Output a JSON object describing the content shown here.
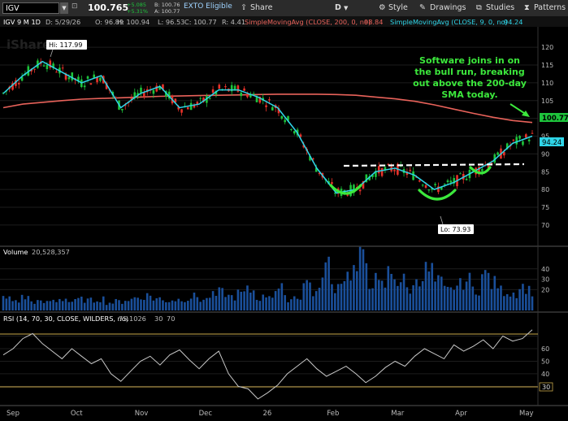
{
  "toolbar": {
    "symbol": "IGV",
    "last": "100.765",
    "change_line1": "+5.085",
    "change_line2": "+5.31%",
    "bid": "B: 100.76",
    "ask": "A: 100.77",
    "exto": "EXTO Eligible",
    "share": "Share",
    "d_label": "D",
    "style": "Style",
    "drawings": "Drawings",
    "studies": "Studies",
    "patterns": "Patterns"
  },
  "header": {
    "period": "IGV 9 M 1D",
    "date": "D: 5/29/26",
    "open": "O: 96.89",
    "high": "H: 100.94",
    "low": "L: 96.53",
    "close": "C: 100.77",
    "range": "R: 4.41",
    "sma200_label": "SimpleMovingAvg (CLOSE, 200, 0, no)",
    "sma200_value": "98.84",
    "sma9_label": "SimpleMovingAvg (CLOSE, 9, 0, no)",
    "sma9_value": "94.24",
    "watermark": "iShares"
  },
  "annotations": {
    "hi": "Hi: 117.99",
    "lo": "Lo: 73.93",
    "callout": [
      "Software joins in on",
      "the bull run, breaking",
      "out above the 200-day",
      "SMA today."
    ]
  },
  "badges": {
    "price": "100.77",
    "sma9": "94.24"
  },
  "volume": {
    "label": "Volume",
    "value": "20,528,357"
  },
  "rsi": {
    "label": "RSI (14, 70, 30, CLOSE, WILDERS, no)",
    "value": "75.1026",
    "ob_label": "30",
    "os_label": "70",
    "level_30": "30"
  },
  "colors": {
    "up": "#1ec43c",
    "down": "#e8322a",
    "sma200": "#e8625a",
    "sma9": "#2fd5e8",
    "volume": "#1a4f9a",
    "rsi": "#c8c8c8",
    "level": "#c9a84a",
    "annotation": "#3ce83c"
  },
  "chart_data": [
    {
      "type": "candlestick",
      "title": "IGV 9 M 1D",
      "x_tick_labels": [
        "Sep",
        "Oct",
        "Nov",
        "Dec",
        "26",
        "Feb",
        "Mar",
        "Apr",
        "May"
      ],
      "y_tick_labels": [
        "70",
        "75",
        "80",
        "85",
        "90",
        "95",
        "100",
        "105",
        "110",
        "115",
        "120"
      ],
      "ylim": [
        67,
        123
      ],
      "grid": true,
      "series": [
        {
          "name": "SimpleMovingAvg (CLOSE, 9, 0, no)",
          "values": [
            107,
            112,
            116,
            113,
            110,
            112,
            103,
            107,
            109,
            103,
            104,
            108,
            108,
            106,
            103,
            96,
            86,
            79,
            80,
            85,
            86,
            84,
            80,
            82,
            85,
            88,
            93,
            95
          ]
        },
        {
          "name": "SimpleMovingAvg (CLOSE, 200, 0, no)",
          "values": [
            103,
            104,
            104.5,
            105,
            105.4,
            105.6,
            105.8,
            106,
            106.2,
            106.3,
            106.4,
            106.5,
            106.6,
            106.7,
            106.8,
            106.8,
            106.8,
            106.7,
            106.5,
            106,
            105.5,
            104.8,
            103.8,
            102.6,
            101.4,
            100.3,
            99.4,
            98.84
          ]
        }
      ],
      "key_levels": {
        "high": 117.99,
        "low": 73.93,
        "last": 100.77,
        "resistance": 88.6
      }
    },
    {
      "type": "bar",
      "title": "Volume",
      "y_tick_labels": [
        "20",
        "30",
        "40"
      ],
      "values": [
        12,
        10,
        13,
        9,
        8,
        10,
        12,
        9,
        11,
        10,
        12,
        8,
        9,
        11,
        13,
        15,
        12,
        10,
        11,
        12,
        14,
        11,
        15,
        18,
        14,
        17,
        20,
        13,
        16,
        22,
        12,
        14,
        28,
        18,
        45,
        25,
        35,
        40,
        50,
        30,
        25,
        38,
        30,
        22,
        35,
        40,
        28,
        20,
        25,
        30,
        22,
        35,
        27,
        20,
        18,
        24,
        20
      ]
    },
    {
      "type": "line",
      "title": "RSI (14, 70, 30, CLOSE, WILDERS, no)",
      "y_tick_labels": [
        "30",
        "40",
        "50",
        "60",
        "70"
      ],
      "ylim": [
        18,
        80
      ],
      "overbought": 70,
      "oversold": 30,
      "values": [
        55,
        60,
        68,
        72,
        64,
        58,
        52,
        60,
        54,
        48,
        52,
        40,
        34,
        42,
        50,
        54,
        47,
        55,
        59,
        51,
        44,
        52,
        58,
        40,
        30,
        28,
        20,
        25,
        31,
        40,
        46,
        52,
        44,
        38,
        42,
        46,
        40,
        33,
        38,
        45,
        50,
        46,
        54,
        60,
        56,
        52,
        63,
        58,
        62,
        67,
        60,
        70,
        66,
        68,
        75
      ]
    }
  ]
}
